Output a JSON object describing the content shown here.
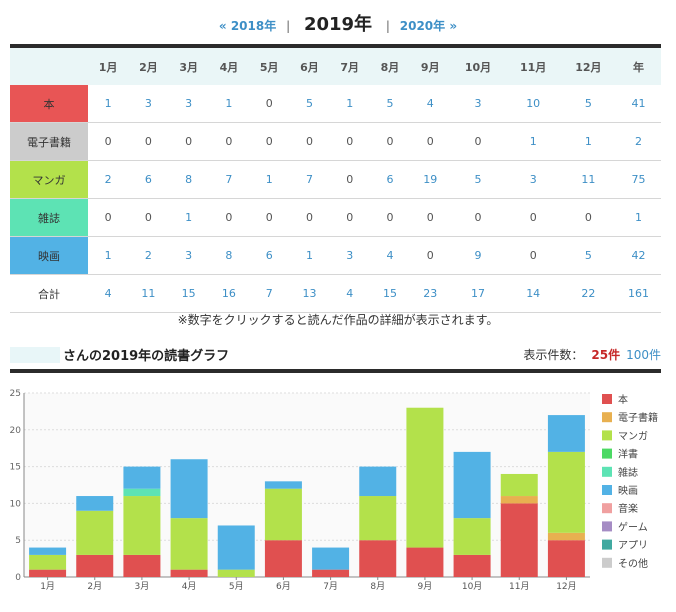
{
  "nav": {
    "prev": "« 2018年",
    "current": "2019年",
    "next": "2020年 »",
    "sep": "|"
  },
  "table": {
    "header": [
      "",
      "1月",
      "2月",
      "3月",
      "4月",
      "5月",
      "6月",
      "7月",
      "8月",
      "9月",
      "10月",
      "11月",
      "12月",
      "年"
    ],
    "rows": [
      {
        "label": "本",
        "color": "#e85555",
        "values": [
          "1",
          "3",
          "3",
          "1",
          "0",
          "5",
          "1",
          "5",
          "4",
          "3",
          "10",
          "5",
          "41"
        ]
      },
      {
        "label": "電子書籍",
        "color": "#cccccc",
        "values": [
          "0",
          "0",
          "0",
          "0",
          "0",
          "0",
          "0",
          "0",
          "0",
          "0",
          "1",
          "1",
          "2"
        ]
      },
      {
        "label": "マンガ",
        "color": "#b3e14b",
        "values": [
          "2",
          "6",
          "8",
          "7",
          "1",
          "7",
          "0",
          "6",
          "19",
          "5",
          "3",
          "11",
          "75"
        ]
      },
      {
        "label": "雑誌",
        "color": "#5de3b4",
        "values": [
          "0",
          "0",
          "1",
          "0",
          "0",
          "0",
          "0",
          "0",
          "0",
          "0",
          "0",
          "0",
          "1"
        ]
      },
      {
        "label": "映画",
        "color": "#52b2e5",
        "values": [
          "1",
          "2",
          "3",
          "8",
          "6",
          "1",
          "3",
          "4",
          "0",
          "9",
          "0",
          "5",
          "42"
        ]
      },
      {
        "label": "合計",
        "color": "",
        "values": [
          "4",
          "11",
          "15",
          "16",
          "7",
          "13",
          "4",
          "15",
          "23",
          "17",
          "14",
          "22",
          "161"
        ]
      }
    ]
  },
  "note": "※数字をクリックすると読んだ作品の詳細が表示されます。",
  "graph": {
    "title": "さんの2019年の読書グラフ",
    "count_label": "表示件数：",
    "count_active": "25件",
    "count_alt": "100件"
  },
  "chart_data": {
    "type": "bar",
    "stacked": true,
    "categories": [
      "1月",
      "2月",
      "3月",
      "4月",
      "5月",
      "6月",
      "7月",
      "8月",
      "9月",
      "10月",
      "11月",
      "12月"
    ],
    "ylim": [
      0,
      25
    ],
    "yticks": [
      0,
      5,
      10,
      15,
      20,
      25
    ],
    "grid": true,
    "legend": "right",
    "series": [
      {
        "name": "本",
        "color": "#e05050",
        "values": [
          1,
          3,
          3,
          1,
          0,
          5,
          1,
          5,
          4,
          3,
          10,
          5
        ]
      },
      {
        "name": "電子書籍",
        "color": "#e8b050",
        "values": [
          0,
          0,
          0,
          0,
          0,
          0,
          0,
          0,
          0,
          0,
          1,
          1
        ]
      },
      {
        "name": "マンガ",
        "color": "#b3e14b",
        "values": [
          2,
          6,
          8,
          7,
          1,
          7,
          0,
          6,
          19,
          5,
          3,
          11
        ]
      },
      {
        "name": "洋書",
        "color": "#4cd964",
        "values": [
          0,
          0,
          0,
          0,
          0,
          0,
          0,
          0,
          0,
          0,
          0,
          0
        ]
      },
      {
        "name": "雑誌",
        "color": "#5de3b4",
        "values": [
          0,
          0,
          1,
          0,
          0,
          0,
          0,
          0,
          0,
          0,
          0,
          0
        ]
      },
      {
        "name": "映画",
        "color": "#52b2e5",
        "values": [
          1,
          2,
          3,
          8,
          6,
          1,
          3,
          4,
          0,
          9,
          0,
          5
        ]
      },
      {
        "name": "音楽",
        "color": "#f0a0a0",
        "values": [
          0,
          0,
          0,
          0,
          0,
          0,
          0,
          0,
          0,
          0,
          0,
          0
        ]
      },
      {
        "name": "ゲーム",
        "color": "#a58cc4",
        "values": [
          0,
          0,
          0,
          0,
          0,
          0,
          0,
          0,
          0,
          0,
          0,
          0
        ]
      },
      {
        "name": "アプリ",
        "color": "#40a9a0",
        "values": [
          0,
          0,
          0,
          0,
          0,
          0,
          0,
          0,
          0,
          0,
          0,
          0
        ]
      },
      {
        "name": "その他",
        "color": "#cccccc",
        "values": [
          0,
          0,
          0,
          0,
          0,
          0,
          0,
          0,
          0,
          0,
          0,
          0
        ]
      }
    ]
  }
}
